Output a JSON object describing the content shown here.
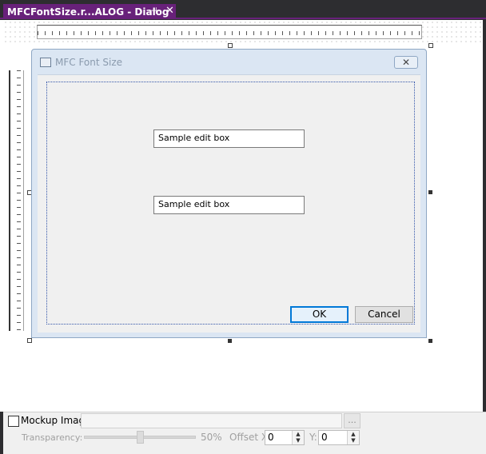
{
  "tab": {
    "title": "MFCFontSize.r...ALOG - Dialog",
    "pin_glyph": "⊣",
    "close_glyph": "✕"
  },
  "dialog": {
    "title": "MFC Font Size",
    "close_glyph": "✕",
    "edit1": "Sample edit box",
    "edit2": "Sample edit box",
    "ok_label": "OK",
    "cancel_label": "Cancel"
  },
  "mockup": {
    "checkbox_label": "Mockup Image:",
    "checked": false,
    "image_path": "",
    "browse_label": "...",
    "transparency_label": "Transparency:",
    "transparency_value": "50%",
    "transparency_level": 0.5,
    "offset_x_label": "Offset X:",
    "offset_x_value": "0",
    "y_label": "Y:",
    "y_value": "0"
  },
  "colors": {
    "tab_accent": "#68217a",
    "dialog_frame": "#dbe6f3",
    "ok_focus": "#0078d7"
  }
}
